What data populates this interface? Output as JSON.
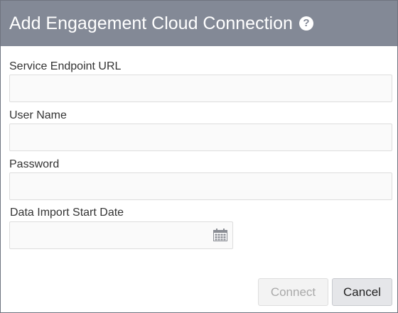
{
  "dialog": {
    "title": "Add Engagement Cloud Connection",
    "help_glyph": "?"
  },
  "form": {
    "service_endpoint_url": {
      "label": "Service Endpoint URL",
      "value": ""
    },
    "user_name": {
      "label": "User Name",
      "value": ""
    },
    "password": {
      "label": "Password",
      "value": ""
    },
    "data_import_start_date": {
      "label": "Data Import Start Date",
      "value": "",
      "icon": "calendar-icon"
    }
  },
  "footer": {
    "connect_label": "Connect",
    "connect_state": "disabled",
    "cancel_label": "Cancel"
  },
  "colors": {
    "titlebar": "#838996",
    "field_bg": "#fafafa",
    "disabled_text": "#a9a9a9"
  }
}
